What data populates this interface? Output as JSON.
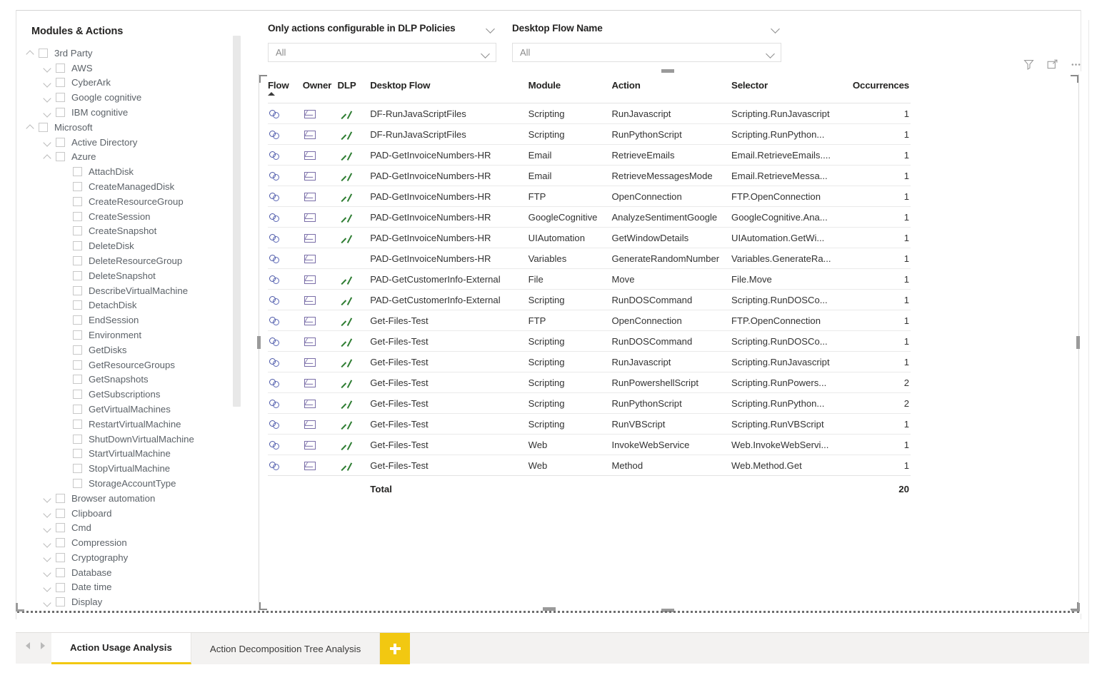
{
  "tree": {
    "title": "Modules & Actions",
    "items": [
      {
        "label": "3rd Party",
        "level": 0,
        "chevron": "up",
        "checkbox": true
      },
      {
        "label": "AWS",
        "level": 1,
        "chevron": "down",
        "checkbox": true
      },
      {
        "label": "CyberArk",
        "level": 1,
        "chevron": "down",
        "checkbox": true
      },
      {
        "label": "Google cognitive",
        "level": 1,
        "chevron": "down",
        "checkbox": true
      },
      {
        "label": "IBM cognitive",
        "level": 1,
        "chevron": "down",
        "checkbox": true
      },
      {
        "label": "Microsoft",
        "level": 0,
        "chevron": "up",
        "checkbox": true
      },
      {
        "label": "Active Directory",
        "level": 1,
        "chevron": "down",
        "checkbox": true
      },
      {
        "label": "Azure",
        "level": 1,
        "chevron": "up",
        "checkbox": true
      },
      {
        "label": "AttachDisk",
        "level": 2,
        "chevron": "none",
        "checkbox": true
      },
      {
        "label": "CreateManagedDisk",
        "level": 2,
        "chevron": "none",
        "checkbox": true
      },
      {
        "label": "CreateResourceGroup",
        "level": 2,
        "chevron": "none",
        "checkbox": true
      },
      {
        "label": "CreateSession",
        "level": 2,
        "chevron": "none",
        "checkbox": true
      },
      {
        "label": "CreateSnapshot",
        "level": 2,
        "chevron": "none",
        "checkbox": true
      },
      {
        "label": "DeleteDisk",
        "level": 2,
        "chevron": "none",
        "checkbox": true
      },
      {
        "label": "DeleteResourceGroup",
        "level": 2,
        "chevron": "none",
        "checkbox": true
      },
      {
        "label": "DeleteSnapshot",
        "level": 2,
        "chevron": "none",
        "checkbox": true
      },
      {
        "label": "DescribeVirtualMachine",
        "level": 2,
        "chevron": "none",
        "checkbox": true
      },
      {
        "label": "DetachDisk",
        "level": 2,
        "chevron": "none",
        "checkbox": true
      },
      {
        "label": "EndSession",
        "level": 2,
        "chevron": "none",
        "checkbox": true
      },
      {
        "label": "Environment",
        "level": 2,
        "chevron": "none",
        "checkbox": true
      },
      {
        "label": "GetDisks",
        "level": 2,
        "chevron": "none",
        "checkbox": true
      },
      {
        "label": "GetResourceGroups",
        "level": 2,
        "chevron": "none",
        "checkbox": true
      },
      {
        "label": "GetSnapshots",
        "level": 2,
        "chevron": "none",
        "checkbox": true
      },
      {
        "label": "GetSubscriptions",
        "level": 2,
        "chevron": "none",
        "checkbox": true
      },
      {
        "label": "GetVirtualMachines",
        "level": 2,
        "chevron": "none",
        "checkbox": true
      },
      {
        "label": "RestartVirtualMachine",
        "level": 2,
        "chevron": "none",
        "checkbox": true
      },
      {
        "label": "ShutDownVirtualMachine",
        "level": 2,
        "chevron": "none",
        "checkbox": true
      },
      {
        "label": "StartVirtualMachine",
        "level": 2,
        "chevron": "none",
        "checkbox": true
      },
      {
        "label": "StopVirtualMachine",
        "level": 2,
        "chevron": "none",
        "checkbox": true
      },
      {
        "label": "StorageAccountType",
        "level": 2,
        "chevron": "none",
        "checkbox": true
      },
      {
        "label": "Browser automation",
        "level": 1,
        "chevron": "down",
        "checkbox": true
      },
      {
        "label": "Clipboard",
        "level": 1,
        "chevron": "down",
        "checkbox": true
      },
      {
        "label": "Cmd",
        "level": 1,
        "chevron": "down",
        "checkbox": true
      },
      {
        "label": "Compression",
        "level": 1,
        "chevron": "down",
        "checkbox": true
      },
      {
        "label": "Cryptography",
        "level": 1,
        "chevron": "down",
        "checkbox": true
      },
      {
        "label": "Database",
        "level": 1,
        "chevron": "down",
        "checkbox": true
      },
      {
        "label": "Date time",
        "level": 1,
        "chevron": "down",
        "checkbox": true
      },
      {
        "label": "Display",
        "level": 1,
        "chevron": "down",
        "checkbox": true
      }
    ]
  },
  "slicers": [
    {
      "title": "Only actions configurable in DLP Policies",
      "value": "All"
    },
    {
      "title": "Desktop Flow Name",
      "value": "All"
    }
  ],
  "visual_header": {
    "filter_icon": "filter-icon",
    "focus_icon": "focus-mode-icon",
    "more_icon": "more-options-icon"
  },
  "table": {
    "columns": [
      "Flow",
      "Owner",
      "DLP",
      "Desktop Flow",
      "Module",
      "Action",
      "Selector",
      "Occurrences"
    ],
    "sort_column": "Flow",
    "sort_direction": "asc",
    "rows": [
      {
        "flow": "flow-link-icon",
        "owner": "owner-mail-icon",
        "dlp": true,
        "desktop_flow": "DF-RunJavaScriptFiles",
        "module": "Scripting",
        "action": "RunJavascript",
        "selector": "Scripting.RunJavascript",
        "occurrences": "1"
      },
      {
        "flow": "flow-link-icon",
        "owner": "owner-mail-icon",
        "dlp": true,
        "desktop_flow": "DF-RunJavaScriptFiles",
        "module": "Scripting",
        "action": "RunPythonScript",
        "selector": "Scripting.RunPython...",
        "occurrences": "1"
      },
      {
        "flow": "flow-link-icon",
        "owner": "owner-mail-icon",
        "dlp": true,
        "desktop_flow": "PAD-GetInvoiceNumbers-HR",
        "module": "Email",
        "action": "RetrieveEmails",
        "selector": "Email.RetrieveEmails....",
        "occurrences": "1"
      },
      {
        "flow": "flow-link-icon",
        "owner": "owner-mail-icon",
        "dlp": true,
        "desktop_flow": "PAD-GetInvoiceNumbers-HR",
        "module": "Email",
        "action": "RetrieveMessagesMode",
        "selector": "Email.RetrieveMessa...",
        "occurrences": "1"
      },
      {
        "flow": "flow-link-icon",
        "owner": "owner-mail-icon",
        "dlp": true,
        "desktop_flow": "PAD-GetInvoiceNumbers-HR",
        "module": "FTP",
        "action": "OpenConnection",
        "selector": "FTP.OpenConnection",
        "occurrences": "1"
      },
      {
        "flow": "flow-link-icon",
        "owner": "owner-mail-icon",
        "dlp": true,
        "desktop_flow": "PAD-GetInvoiceNumbers-HR",
        "module": "GoogleCognitive",
        "action": "AnalyzeSentimentGoogle",
        "selector": "GoogleCognitive.Ana...",
        "occurrences": "1"
      },
      {
        "flow": "flow-link-icon",
        "owner": "owner-mail-icon",
        "dlp": true,
        "desktop_flow": "PAD-GetInvoiceNumbers-HR",
        "module": "UIAutomation",
        "action": "GetWindowDetails",
        "selector": "UIAutomation.GetWi...",
        "occurrences": "1"
      },
      {
        "flow": "flow-link-icon",
        "owner": "owner-mail-icon",
        "dlp": false,
        "desktop_flow": "PAD-GetInvoiceNumbers-HR",
        "module": "Variables",
        "action": "GenerateRandomNumber",
        "selector": "Variables.GenerateRa...",
        "occurrences": "1"
      },
      {
        "flow": "flow-link-icon",
        "owner": "owner-mail-icon",
        "dlp": true,
        "desktop_flow": "PAD-GetCustomerInfo-External",
        "module": "File",
        "action": "Move",
        "selector": "File.Move",
        "occurrences": "1"
      },
      {
        "flow": "flow-link-icon",
        "owner": "owner-mail-icon",
        "dlp": true,
        "desktop_flow": "PAD-GetCustomerInfo-External",
        "module": "Scripting",
        "action": "RunDOSCommand",
        "selector": "Scripting.RunDOSCo...",
        "occurrences": "1"
      },
      {
        "flow": "flow-link-icon",
        "owner": "owner-mail-icon",
        "dlp": true,
        "desktop_flow": "Get-Files-Test",
        "module": "FTP",
        "action": "OpenConnection",
        "selector": "FTP.OpenConnection",
        "occurrences": "1"
      },
      {
        "flow": "flow-link-icon",
        "owner": "owner-mail-icon",
        "dlp": true,
        "desktop_flow": "Get-Files-Test",
        "module": "Scripting",
        "action": "RunDOSCommand",
        "selector": "Scripting.RunDOSCo...",
        "occurrences": "1"
      },
      {
        "flow": "flow-link-icon",
        "owner": "owner-mail-icon",
        "dlp": true,
        "desktop_flow": "Get-Files-Test",
        "module": "Scripting",
        "action": "RunJavascript",
        "selector": "Scripting.RunJavascript",
        "occurrences": "1"
      },
      {
        "flow": "flow-link-icon",
        "owner": "owner-mail-icon",
        "dlp": true,
        "desktop_flow": "Get-Files-Test",
        "module": "Scripting",
        "action": "RunPowershellScript",
        "selector": "Scripting.RunPowers...",
        "occurrences": "2"
      },
      {
        "flow": "flow-link-icon",
        "owner": "owner-mail-icon",
        "dlp": true,
        "desktop_flow": "Get-Files-Test",
        "module": "Scripting",
        "action": "RunPythonScript",
        "selector": "Scripting.RunPython...",
        "occurrences": "2"
      },
      {
        "flow": "flow-link-icon",
        "owner": "owner-mail-icon",
        "dlp": true,
        "desktop_flow": "Get-Files-Test",
        "module": "Scripting",
        "action": "RunVBScript",
        "selector": "Scripting.RunVBScript",
        "occurrences": "1"
      },
      {
        "flow": "flow-link-icon",
        "owner": "owner-mail-icon",
        "dlp": true,
        "desktop_flow": "Get-Files-Test",
        "module": "Web",
        "action": "InvokeWebService",
        "selector": "Web.InvokeWebServi...",
        "occurrences": "1"
      },
      {
        "flow": "flow-link-icon",
        "owner": "owner-mail-icon",
        "dlp": true,
        "desktop_flow": "Get-Files-Test",
        "module": "Web",
        "action": "Method",
        "selector": "Web.Method.Get",
        "occurrences": "1"
      }
    ],
    "total_label": "Total",
    "total_value": "20"
  },
  "tabbar": {
    "tabs": [
      {
        "label": "Action Usage Analysis",
        "active": true
      },
      {
        "label": "Action Decomposition Tree Analysis",
        "active": false
      }
    ],
    "add_label": "+"
  },
  "colors": {
    "accent": "#f2c811",
    "dlp_check": "#2e7d32",
    "flow_icon": "#4a56a6",
    "owner_icon": "#7a6ea8"
  }
}
